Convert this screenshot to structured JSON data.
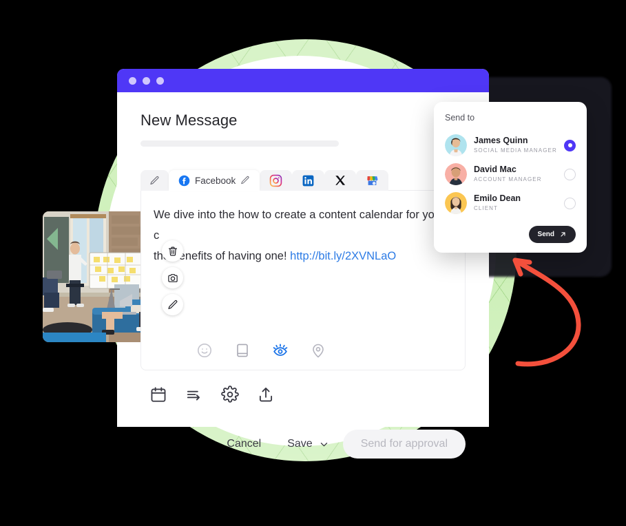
{
  "window": {
    "title": "New Message",
    "traffic_lights": [
      "dot-1",
      "dot-2",
      "dot-3"
    ],
    "titlebar_color": "#4F37F6"
  },
  "composer": {
    "tabs": [
      {
        "id": "edit-all",
        "label": "",
        "icon": "pencil-icon",
        "active": false
      },
      {
        "id": "facebook",
        "label": "Facebook",
        "icon": "facebook-icon",
        "active": true,
        "edit_icon": "pencil-icon"
      },
      {
        "id": "instagram",
        "label": "",
        "icon": "instagram-icon",
        "active": false
      },
      {
        "id": "linkedin",
        "label": "",
        "icon": "linkedin-icon",
        "active": false
      },
      {
        "id": "x",
        "label": "",
        "icon": "x-twitter-icon",
        "active": false
      },
      {
        "id": "google-business",
        "label": "",
        "icon": "google-business-icon",
        "active": false
      }
    ],
    "message_part_1": "We dive into the how to create a content calendar for your c",
    "message_part_2": "the benefits of having one! ",
    "message_link": "http://bit.ly/2XVNLaO",
    "inline_tools": [
      {
        "id": "emoji",
        "icon": "smiley-icon",
        "active": false
      },
      {
        "id": "saved-replies",
        "icon": "note-icon",
        "active": false
      },
      {
        "id": "preview",
        "icon": "eye-icon",
        "active": true,
        "color": "#1A73E8"
      },
      {
        "id": "location",
        "icon": "location-pin-icon",
        "active": false
      }
    ]
  },
  "attachment": {
    "alt": "team workshop with sticky-note whiteboard",
    "actions": [
      {
        "id": "delete",
        "icon": "trash-icon"
      },
      {
        "id": "replace",
        "icon": "camera-icon"
      },
      {
        "id": "edit",
        "icon": "pencil-icon"
      }
    ]
  },
  "toolbar": [
    {
      "id": "schedule",
      "icon": "calendar-icon"
    },
    {
      "id": "queue",
      "icon": "shuffle-arrow-icon"
    },
    {
      "id": "settings",
      "icon": "gear-icon"
    },
    {
      "id": "share",
      "icon": "upload-icon"
    }
  ],
  "actions": {
    "cancel_label": "Cancel",
    "save_label": "Save",
    "save_chevron": "chevron-down-icon",
    "approval_label": "Send for approval"
  },
  "popover": {
    "title": "Send to",
    "recipients": [
      {
        "name": "James Quinn",
        "role": "SOCIAL MEDIA MANAGER",
        "selected": true,
        "avatar_bg": "#AFE3EE"
      },
      {
        "name": "David Mac",
        "role": "ACCOUNT MANAGER",
        "selected": false,
        "avatar_bg": "#F8AFA5"
      },
      {
        "name": "Emilo Dean",
        "role": "CLIENT",
        "selected": false,
        "avatar_bg": "#FBC652"
      }
    ],
    "send_label": "Send",
    "send_icon": "arrow-up-right-icon",
    "accent_color": "#4F37F6"
  },
  "annotation": {
    "arrow_color": "#F4503C",
    "icon": "curved-arrow-icon"
  },
  "decor": {
    "green_circle_color": "#CAEFB4",
    "white_circle_color": "#FFFFFF",
    "background_color": "#000000"
  }
}
